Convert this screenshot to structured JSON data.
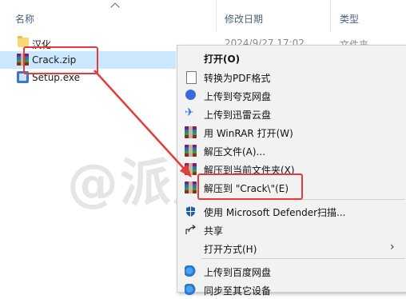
{
  "header": {
    "col_name": "名称",
    "col_date": "修改日期",
    "col_type": "类型"
  },
  "files": [
    {
      "name": "汉化",
      "date": "2024/9/27 17:02",
      "type": "文件夹",
      "icon": "folder-icon"
    },
    {
      "name": "Crack.zip",
      "icon": "winrar-archive-icon",
      "selected": true
    },
    {
      "name": "Setup.exe",
      "icon": "setup-exe-icon"
    }
  ],
  "context_menu": {
    "items": [
      {
        "label": "打开(O)",
        "bold": true,
        "icon": ""
      },
      {
        "label": "转换为PDF格式",
        "icon": "pdf-convert-icon"
      },
      {
        "label": "上传到夸克网盘",
        "icon": "quark-icon"
      },
      {
        "label": "上传到迅雷云盘",
        "icon": "xunlei-icon"
      },
      {
        "label": "用 WinRAR 打开(W)",
        "icon": "winrar-icon"
      },
      {
        "label": "解压文件(A)...",
        "icon": "winrar-icon"
      },
      {
        "label": "解压到当前文件夹(X)",
        "icon": "winrar-icon"
      },
      {
        "label": "解压到 \"Crack\\\"(E)",
        "icon": "winrar-icon"
      },
      {
        "label": "使用 Microsoft Defender扫描...",
        "icon": "defender-shield-icon"
      },
      {
        "label": "共享",
        "icon": "share-icon"
      },
      {
        "label": "打开方式(H)",
        "icon": "",
        "submenu": true
      },
      {
        "label": "上传到百度网盘",
        "icon": "baidu-netdisk-icon"
      },
      {
        "label": "同步至其它设备",
        "icon": "baidu-netdisk-icon"
      }
    ]
  },
  "watermark": "@派风",
  "colors": {
    "selection": "#cce8ff",
    "highlight_box": "#e43b3b",
    "arrow": "#e43b3b"
  }
}
